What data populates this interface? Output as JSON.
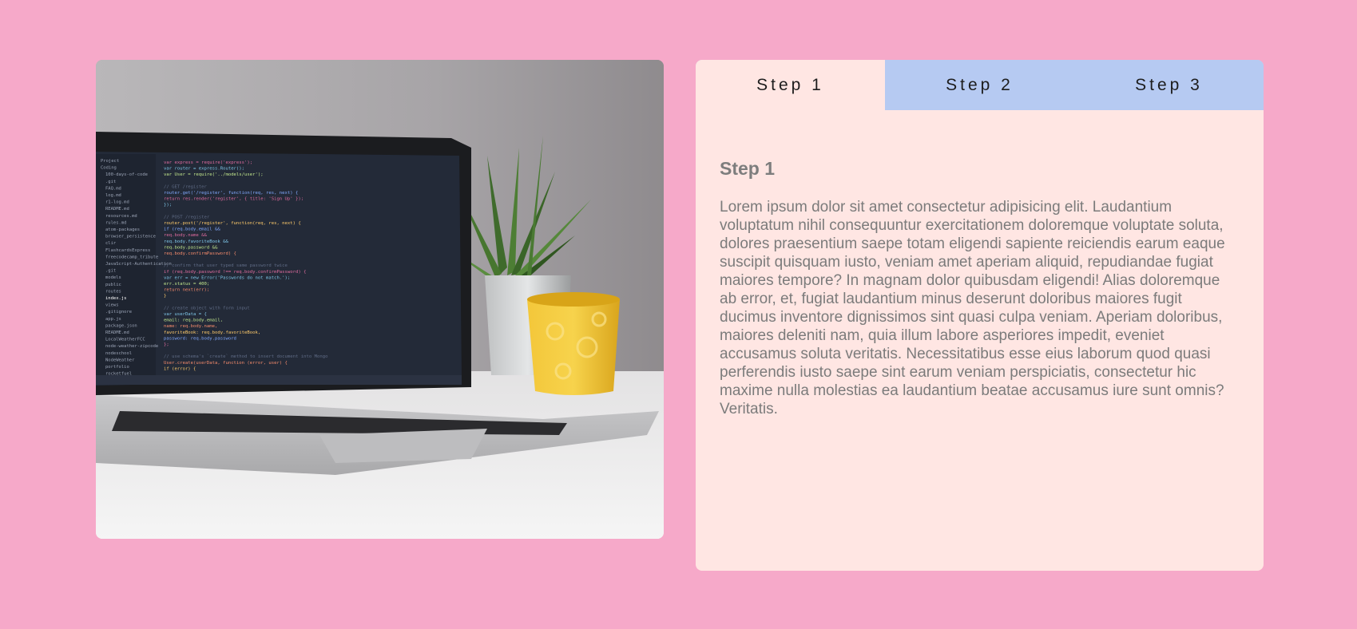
{
  "image": {
    "subject": "laptop-with-code-editor",
    "code_lines": [
      "var express = require('express');",
      "var router = express.Router();",
      "var User = require('../models/user');",
      "",
      "// GET /register",
      "router.get('/register', function(req, res, next) {",
      "  return res.render('register', { title: 'Sign Up' });",
      "});",
      "",
      "// POST /register",
      "router.post('/register', function(req, res, next) {",
      "  if (req.body.email &&",
      "    req.body.name &&",
      "    req.body.favoriteBook &&",
      "    req.body.password &&",
      "    req.body.confirmPassword) {",
      "",
      "    // confirm that user typed same password twice",
      "    if (req.body.password !== req.body.confirmPassword) {",
      "      var err = new Error('Passwords do not match.');",
      "      err.status = 400;",
      "      return next(err);",
      "    }",
      "",
      "    // create object with form input",
      "    var userData = {",
      "      email: req.body.email,",
      "      name: req.body.name,",
      "      favoriteBook: req.body.favoriteBook,",
      "      password: req.body.password",
      "    };",
      "",
      "    // use schema's `create` method to insert document into Mongo",
      "    User.create(userData, function (error, user) {",
      "      if (error) {"
    ],
    "tree_items": [
      "Project",
      "Coding",
      "100-days-of-code",
      ".git",
      "FAQ.md",
      "log.md",
      "r1-log.md",
      "README.md",
      "resources.md",
      "rules.md",
      "atom-packages",
      "browser_persistence",
      "clir",
      "FlashcardsExpress",
      "freecodecamp_tribute",
      "JavaScript-Authentication",
      ".git",
      "models",
      "public",
      "routes",
      "index.js",
      "views",
      ".gitignore",
      "app.js",
      "package.json",
      "README.md",
      "LocalWeatherFCC",
      "node-weather-zipcode",
      "nodeschool",
      "NodeWeather",
      "portfolio",
      "rocketfuel"
    ]
  },
  "tabs": [
    {
      "label": "Step 1",
      "active": true
    },
    {
      "label": "Step 2",
      "active": false
    },
    {
      "label": "Step 3",
      "active": false
    }
  ],
  "content": {
    "title": "Step 1",
    "body": "Lorem ipsum dolor sit amet consectetur adipisicing elit. Laudantium voluptatum nihil consequuntur exercitationem doloremque voluptate soluta, dolores praesentium saepe totam eligendi sapiente reiciendis earum eaque suscipit quisquam iusto, veniam amet aperiam aliquid, repudiandae fugiat maiores tempore? In magnam dolor quibusdam eligendi! Alias doloremque ab error, et, fugiat laudantium minus deserunt doloribus maiores fugit ducimus inventore dignissimos sint quasi culpa veniam. Aperiam doloribus, maiores deleniti nam, quia illum labore asperiores impedit, eveniet accusamus soluta veritatis. Necessitatibus esse eius laborum quod quasi perferendis iusto saepe sint earum veniam perspiciatis, consectetur hic maxime nulla molestias ea laudantium beatae accusamus iure sunt omnis? Veritatis."
  },
  "colors": {
    "page_background": "#f6a9c9",
    "panel_background": "#ffe6e3",
    "tab_inactive": "#b6caf2",
    "text_muted": "#7b7b7b"
  }
}
